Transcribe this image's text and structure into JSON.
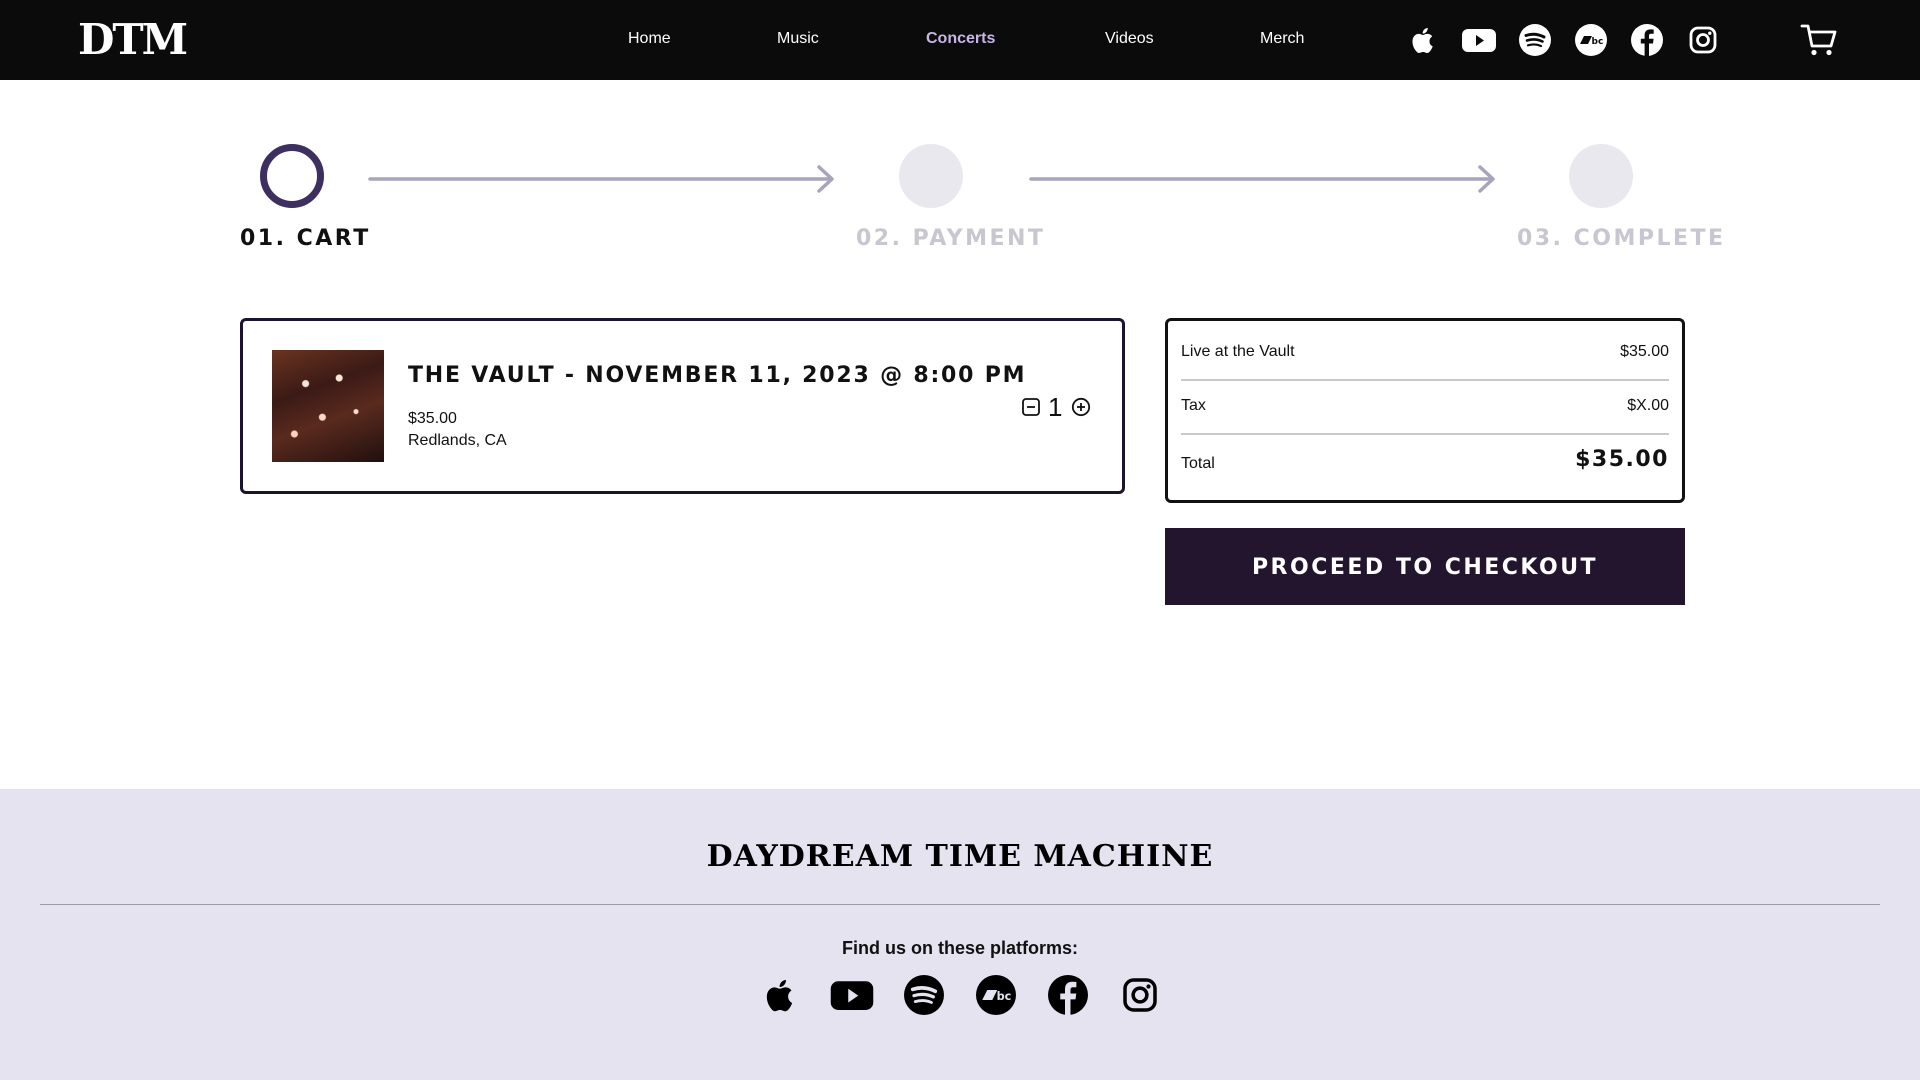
{
  "header": {
    "logo": "DTM",
    "nav": [
      {
        "label": "Home",
        "active": false
      },
      {
        "label": "Music",
        "active": false
      },
      {
        "label": "Concerts",
        "active": true
      },
      {
        "label": "Videos",
        "active": false
      },
      {
        "label": "Merch",
        "active": false
      }
    ],
    "social_icons": [
      "apple-music-icon",
      "youtube-icon",
      "spotify-icon",
      "bandcamp-icon",
      "facebook-icon",
      "instagram-icon"
    ],
    "cart_icon": "cart-icon"
  },
  "steps": [
    {
      "label": "01. CART",
      "active": true
    },
    {
      "label": "02. PAYMENT",
      "active": false
    },
    {
      "label": "03. COMPLETE",
      "active": false
    }
  ],
  "cart_item": {
    "title": "THE VAULT - NOVEMBER 11, 2023 @ 8:00 PM",
    "price": "$35.00",
    "location": "Redlands, CA",
    "quantity": "1"
  },
  "summary": {
    "rows": [
      {
        "label": "Live at the Vault",
        "value": "$35.00"
      },
      {
        "label": "Tax",
        "value": "$X.00"
      }
    ],
    "total_label": "Total",
    "total_value": "$35.00"
  },
  "checkout_button": "PROCEED TO CHECKOUT",
  "footer": {
    "logo": "DAYDREAM TIME MACHINE",
    "tagline": "Find us on these platforms:",
    "social_icons": [
      "apple-music-icon",
      "youtube-icon",
      "spotify-icon",
      "bandcamp-icon",
      "facebook-icon",
      "instagram-icon"
    ]
  },
  "colors": {
    "header_bg": "#0b0b0b",
    "nav_active": "#c8b4e6",
    "step_active": "#3d3060",
    "step_inactive": "#e9e8ee",
    "step_arrow": "#a8a4bc",
    "button_bg": "#24152f",
    "footer_bg": "#e6e3f1"
  }
}
